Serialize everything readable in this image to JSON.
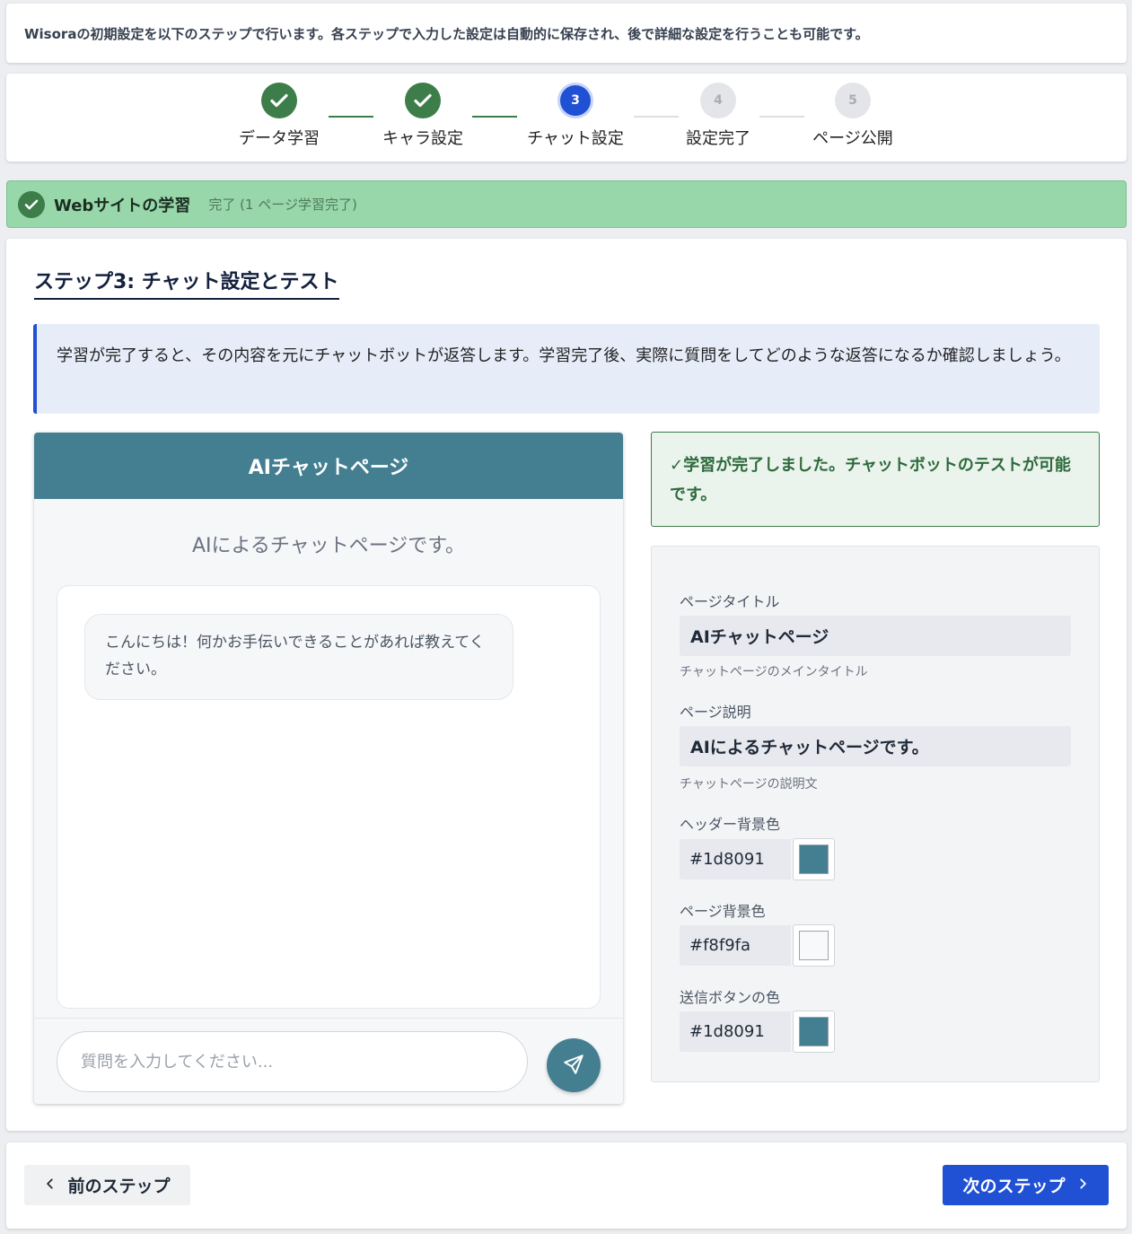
{
  "intro": {
    "text": "Wisoraの初期設定を以下のステップで行います。各ステップで入力した設定は自動的に保存され、後で詳細な設定を行うことも可能です。"
  },
  "steps": [
    {
      "label": "データ学習",
      "state": "done",
      "num": ""
    },
    {
      "label": "キャラ設定",
      "state": "done",
      "num": ""
    },
    {
      "label": "チャット設定",
      "state": "active",
      "num": "3"
    },
    {
      "label": "設定完了",
      "state": "todo",
      "num": "4"
    },
    {
      "label": "ページ公開",
      "state": "todo",
      "num": "5"
    }
  ],
  "status": {
    "title": "Webサイトの学習",
    "detail": "完了 (1 ページ学習完了)"
  },
  "section": {
    "title": "ステップ3: チャット設定とテスト",
    "info": "学習が完了すると、その内容を元にチャットボットが返答します。学習完了後、実際に質問をしてどのような返答になるか確認しましょう。"
  },
  "chat": {
    "header": "AIチャットページ",
    "description": "AIによるチャットページです。",
    "greeting": "こんにちは！何かお手伝いできることがあれば教えてください。",
    "input_placeholder": "質問を入力してください..."
  },
  "success": {
    "text": "✓学習が完了しました。チャットボットのテストが可能です。"
  },
  "settings": {
    "page_title_label": "ページタイトル",
    "page_title_value": "AIチャットページ",
    "page_title_help": "チャットページのメインタイトル",
    "page_desc_label": "ページ説明",
    "page_desc_value": "AIによるチャットページです。",
    "page_desc_help": "チャットページの説明文",
    "header_bg_label": "ヘッダー背景色",
    "header_bg_value": "#1d8091",
    "page_bg_label": "ページ背景色",
    "page_bg_value": "#f8f9fa",
    "send_btn_label": "送信ボタンの色",
    "send_btn_value": "#1d8091"
  },
  "nav": {
    "prev": "前のステップ",
    "next": "次のステップ"
  },
  "colors": {
    "primary": "#2050d4",
    "done": "#3c7d4a",
    "chat_header": "#447f91",
    "swatch_header": "#447f91",
    "swatch_page": "#f8f9fa",
    "swatch_send": "#447f91"
  }
}
